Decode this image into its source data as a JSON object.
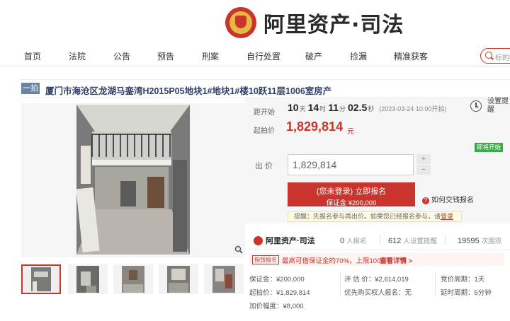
{
  "brand": {
    "name": "阿里资产·司法"
  },
  "nav": {
    "items": [
      "首页",
      "法院",
      "公告",
      "预告",
      "刑案",
      "自行处置",
      "破产",
      "捡漏",
      "精准获客"
    ],
    "search_placeholder": "标的物"
  },
  "item": {
    "tag": "一拍",
    "title": "厦门市海沧区龙湖马銮湾H2015P05地块1#地块1#楼10跃11层1006室房产"
  },
  "countdown": {
    "label": "距开始",
    "days": "10",
    "days_unit": "天",
    "hours": "14",
    "hours_unit": "时",
    "minutes": "11",
    "minutes_unit": "分",
    "seconds": "02.5",
    "seconds_unit": "秒",
    "start_time": "(2023-03-24 10:00开拍)"
  },
  "starting_price": {
    "label": "起拍价",
    "value": "1,829,814",
    "unit": "元"
  },
  "reminder": {
    "label": "设置提醒"
  },
  "status_badge": "即将开始",
  "bid": {
    "label": "出  价",
    "value": "1,829,814",
    "plus": "+",
    "minus": "−"
  },
  "signup": {
    "line1": "(您未登录) 立即报名",
    "line2": "保证金 ¥200,000"
  },
  "help": {
    "label": "如何交钱报名"
  },
  "tip": {
    "text": "提醒：先报名参与再出价。如果您已经报名参与，请",
    "link": "登录"
  },
  "stats": {
    "brand": "阿里资产·司法",
    "signups_value": "0",
    "signups_label": "人报名",
    "reminders_value": "612",
    "reminders_label": "人设置提醒",
    "views_value": "19595",
    "views_label": "次围观"
  },
  "promo": {
    "tag": "指钱报名",
    "text": "最高可借保证金的70%，上限100万",
    "link": "查看详情 >"
  },
  "details": {
    "deposit": "保证金：¥200,000",
    "start_price": "起拍价：¥1,829,814",
    "increment": "加价幅度：¥8,000",
    "appraisal": "评 估 价：¥2,614,019",
    "priority": "优先购买权人报名：无",
    "cycle": "竞价周期：1天",
    "delay": "延时周期：5分钟"
  }
}
